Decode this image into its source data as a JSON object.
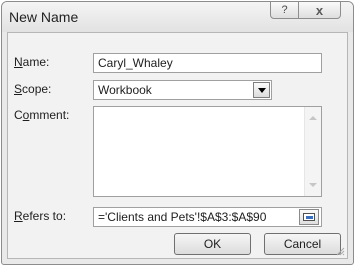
{
  "window": {
    "title": "New Name"
  },
  "titlebar": {
    "help_glyph": "?",
    "close_glyph": "x"
  },
  "form": {
    "name": {
      "label_prefix": "",
      "label_key": "N",
      "label_rest": "ame:",
      "value": "Caryl_Whaley"
    },
    "scope": {
      "label_prefix": "",
      "label_key": "S",
      "label_rest": "cope:",
      "value": "Workbook"
    },
    "comment": {
      "label_prefix": "C",
      "label_key": "o",
      "label_rest": "mment:",
      "value": ""
    },
    "refers_to": {
      "label_prefix": "",
      "label_key": "R",
      "label_rest": "efers to:",
      "value": "='Clients and Pets'!$A$3:$A$90"
    }
  },
  "buttons": {
    "ok": "OK",
    "cancel": "Cancel"
  },
  "icons": {
    "help": "question-icon",
    "close": "close-icon",
    "dropdown": "chevron-down-icon",
    "scroll_up": "scroll-up-icon",
    "scroll_down": "scroll-down-icon",
    "collapse": "collapse-dialog-icon",
    "grip": "resize-grip-icon"
  }
}
